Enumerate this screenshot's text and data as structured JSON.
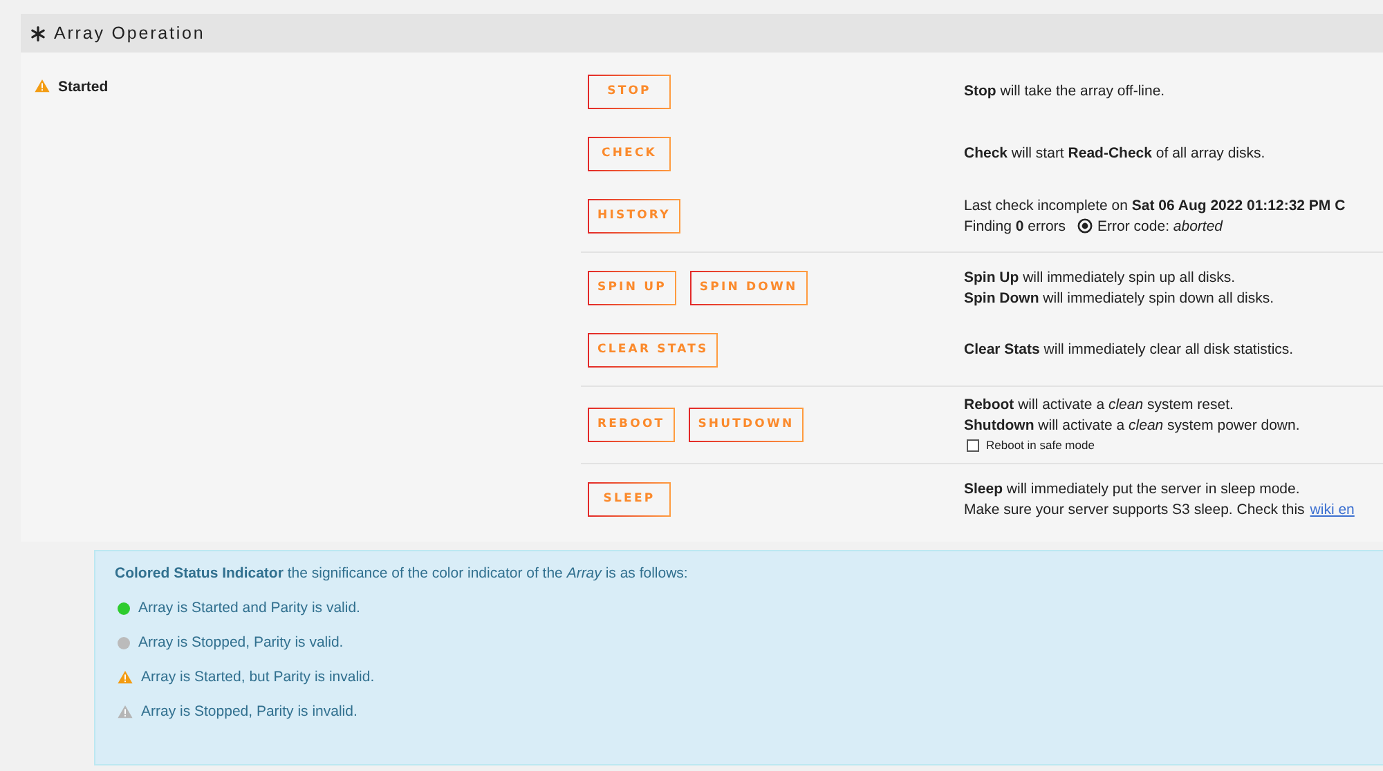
{
  "panel": {
    "title": "Array Operation",
    "status": {
      "label": "Started"
    },
    "sections": [
      {
        "rows": [
          {
            "buttons": [
              "STOP"
            ],
            "lines": [
              {
                "kind": "text",
                "text": "**Stop** will take the array off-line."
              }
            ]
          },
          {
            "buttons": [
              "CHECK"
            ],
            "lines": [
              {
                "kind": "text",
                "text": "**Check** will start **Read-Check** of all array disks."
              }
            ]
          },
          {
            "buttons": [
              "HISTORY"
            ],
            "lines": [
              {
                "kind": "text",
                "text": "Last check incomplete on **Sat 06 Aug 2022 01:12:32 PM C**"
              },
              {
                "kind": "error-code",
                "before": "Finding **0** errors",
                "after": "Error code: *aborted*"
              }
            ]
          }
        ]
      },
      {
        "rows": [
          {
            "buttons": [
              "SPIN UP",
              "SPIN DOWN"
            ],
            "lines": [
              {
                "kind": "text",
                "text": "**Spin Up** will immediately spin up all disks."
              },
              {
                "kind": "text",
                "text": "**Spin Down** will immediately spin down all disks."
              }
            ]
          },
          {
            "buttons": [
              "CLEAR STATS"
            ],
            "lines": [
              {
                "kind": "text",
                "text": "**Clear Stats** will immediately clear all disk statistics."
              }
            ]
          }
        ]
      },
      {
        "rows": [
          {
            "buttons": [
              "REBOOT",
              "SHUTDOWN"
            ],
            "lines": [
              {
                "kind": "text",
                "text": "**Reboot** will activate a *clean* system reset."
              },
              {
                "kind": "text",
                "text": "**Shutdown** will activate a *clean* system power down."
              },
              {
                "kind": "checkbox",
                "label": "Reboot in safe mode",
                "checked": false
              }
            ]
          }
        ]
      },
      {
        "rows": [
          {
            "buttons": [
              "SLEEP"
            ],
            "lines": [
              {
                "kind": "text",
                "text": "**Sleep** will immediately put the server in sleep mode."
              },
              {
                "kind": "link-line",
                "text": "Make sure your server supports S3 sleep. Check this",
                "link": "wiki en"
              }
            ]
          }
        ]
      }
    ]
  },
  "legend": {
    "intro": "**Colored Status Indicator** the significance of the color indicator of the *Array* is as follows:",
    "items": [
      {
        "kind": "dot",
        "color": "#2ecc2e",
        "label": "Array is Started and Parity is valid."
      },
      {
        "kind": "dot",
        "color": "#bbbbbb",
        "label": "Array is Stopped, Parity is valid."
      },
      {
        "kind": "warning",
        "color": "#f39c12",
        "label": "Array is Started, but Parity is invalid."
      },
      {
        "kind": "warning",
        "color": "#b5b5b5",
        "label": "Array is Stopped, Parity is invalid."
      }
    ]
  }
}
